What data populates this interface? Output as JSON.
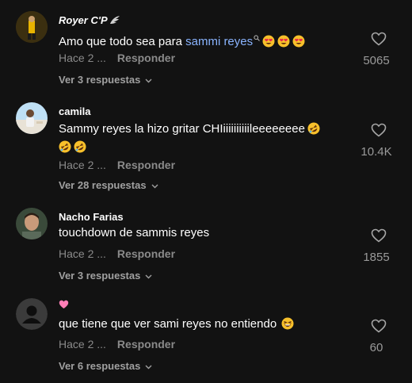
{
  "comments": [
    {
      "username": "Royer C'P",
      "text_prefix": "Amo que todo sea para ",
      "mention": "sammi reyes",
      "time": "Hace 2 ...",
      "reply_label": "Responder",
      "replies_label": "Ver 3 respuestas",
      "likes": "5065"
    },
    {
      "username": "camila",
      "text": "Sammy reyes la hizo gritar CHIiiiiiiiiiileeeeeeee",
      "time": "Hace 2 ...",
      "reply_label": "Responder",
      "replies_label": "Ver 28 respuestas",
      "likes": "10.4K"
    },
    {
      "username": "Nacho Farias",
      "text": "touchdown de sammis reyes",
      "time": "Hace 2 ...",
      "reply_label": "Responder",
      "replies_label": "Ver 3 respuestas",
      "likes": "1855"
    },
    {
      "username": "",
      "text": "que tiene que ver sami reyes no entiendo",
      "time": "Hace 2 ...",
      "reply_label": "Responder",
      "replies_label": "Ver 6 respuestas",
      "likes": "60"
    }
  ],
  "colors": {
    "background": "#121212",
    "mention": "#8ab4ff",
    "muted": "#8a8a8a",
    "heart_badge": "#ff7eb6"
  },
  "icons": [
    "heart-outline-icon",
    "chevron-down-icon",
    "search-icon",
    "wing-icon",
    "heart-eyes-emoji",
    "rofl-emoji",
    "laughing-emoji",
    "pink-heart-emoji"
  ]
}
